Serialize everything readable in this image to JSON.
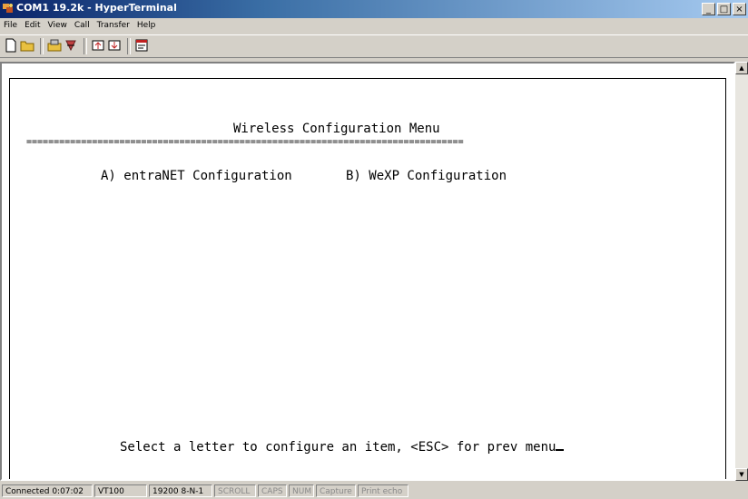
{
  "window": {
    "title": "COM1 19.2k - HyperTerminal",
    "buttons": [
      "_",
      "□",
      "×"
    ]
  },
  "menubar": {
    "items": [
      "File",
      "Edit",
      "View",
      "Call",
      "Transfer",
      "Help"
    ]
  },
  "toolbar": {
    "icons": [
      "new-icon",
      "open-icon",
      "disconnect-icon",
      "hangup-icon",
      "send-icon",
      "receive-icon",
      "properties-icon"
    ]
  },
  "terminal": {
    "menu_title": "Wireless Configuration Menu",
    "separator": "================================================================================",
    "option_a": "A) entraNET Configuration",
    "option_b": "B) WeXP Configuration",
    "prompt": "Select a letter to configure an item, <ESC> for prev menu"
  },
  "statusbar": {
    "connected": "Connected 0:07:02",
    "emulation": "VT100",
    "settings": "19200 8-N-1",
    "scroll": "SCROLL",
    "caps": "CAPS",
    "num": "NUM",
    "capture": "Capture",
    "print_echo": "Print echo"
  }
}
